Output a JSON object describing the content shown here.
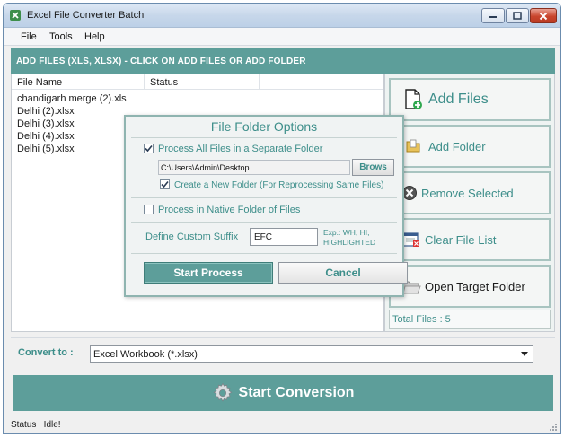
{
  "window": {
    "title": "Excel File Converter Batch"
  },
  "menu": {
    "items": [
      "File",
      "Tools",
      "Help"
    ]
  },
  "header": {
    "text": "ADD FILES (XLS, XLSX) - CLICK ON ADD FILES OR ADD FOLDER"
  },
  "file_list": {
    "columns": [
      "File Name",
      "Status",
      ""
    ],
    "rows": [
      "chandigarh merge (2).xls",
      "Delhi (2).xlsx",
      "Delhi (3).xlsx",
      "Delhi (4).xlsx",
      "Delhi (5).xlsx"
    ]
  },
  "side": {
    "add_files": "Add Files",
    "add_folder": "Add Folder",
    "remove_selected": "Remove Selected",
    "clear_list": "Clear File List",
    "open_target": "Open Target Folder",
    "total_files": "Total Files : 5"
  },
  "dialog": {
    "title": "File Folder Options",
    "process_separate": "Process All Files in a Separate Folder",
    "process_separate_checked": true,
    "path": "C:\\Users\\Admin\\Desktop",
    "brows": "Brows",
    "create_new_folder": "Create a New Folder (For Reprocessing Same Files)",
    "create_new_folder_checked": true,
    "process_native": "Process in Native Folder of Files",
    "process_native_checked": false,
    "suffix_label": "Define Custom Suffix",
    "suffix_value": "EFC",
    "suffix_hint_1": "Exp.: WH, HI,",
    "suffix_hint_2": "HIGHLIGHTED",
    "start": "Start Process",
    "cancel": "Cancel"
  },
  "convert": {
    "label": "Convert to :",
    "selected": "Excel Workbook (*.xlsx)"
  },
  "start_conversion": "Start Conversion",
  "status": {
    "text": "Status :  Idle!"
  },
  "colors": {
    "accent": "#5d9e9a",
    "accent_text": "#3d8e8a"
  }
}
